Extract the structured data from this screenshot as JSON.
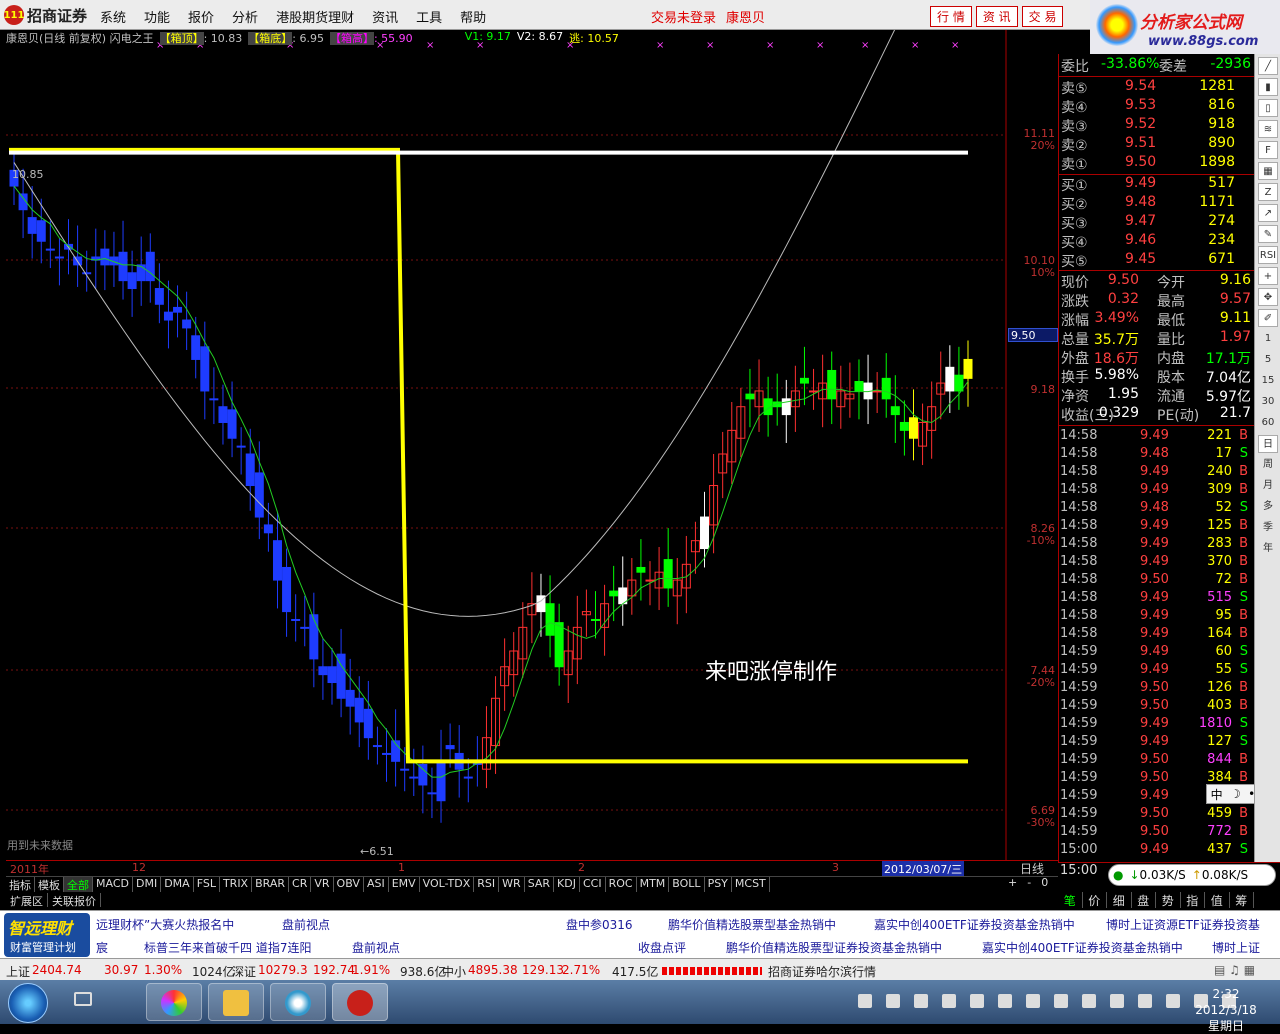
{
  "menubar": {
    "logo_text": "招商证券",
    "items": [
      "系统",
      "功能",
      "报价",
      "分析",
      "港股期货理财",
      "资讯",
      "工具",
      "帮助"
    ],
    "status": "交易未登录",
    "stock_name": "康恩贝",
    "quick_buttons": [
      "行 情",
      "资 讯",
      "交 易"
    ]
  },
  "banner": {
    "title": "分析家公式网",
    "url": "www.88gs.com"
  },
  "infobar": {
    "title": "康恩贝(日线 前复权) 闪电之王",
    "box_top_label": "【箱顶】",
    "box_top_value": ": 10.83",
    "box_bottom_label": "【箱底】",
    "box_bottom_value": ": 6.95",
    "box_high_label": "【箱高】",
    "box_high_value": ": 55.90",
    "v1": "V1: 9.17",
    "v2": "V2: 8.67",
    "escape": "逃: 10.57"
  },
  "chart": {
    "annotation": "来吧涨停制作",
    "future_note": "用到未来数据",
    "max_label": "10.85",
    "min_label": "←6.51",
    "price_axis": [
      {
        "price": "11.11",
        "pct": "20%"
      },
      {
        "price": "10.10",
        "pct": "10%"
      },
      {
        "price": "9.18",
        "pct": ""
      },
      {
        "price": "8.26",
        "pct": "-10%"
      },
      {
        "price": "7.44",
        "pct": "-20%"
      },
      {
        "price": "6.69",
        "pct": "-30%"
      }
    ],
    "current_price": "9.50",
    "date_labels": [
      "2011年",
      "12",
      "1",
      "2",
      "3"
    ],
    "current_date": "2012/03/07/三",
    "period": "日线"
  },
  "chart_data": {
    "type": "candlestick",
    "title": "康恩贝(日线 前复权) 闪电之王",
    "box_top": 10.83,
    "box_bottom": 6.95,
    "max_price": 10.85,
    "min_price": 6.51,
    "current_price": 9.5,
    "ylim": [
      6.4,
      11.4
    ]
  },
  "tabs": [
    "指标",
    "模板",
    "全部",
    "MACD",
    "DMI",
    "DMA",
    "FSL",
    "TRIX",
    "BRAR",
    "CR",
    "VR",
    "OBV",
    "ASI",
    "EMV",
    "VOL-TDX",
    "RSI",
    "WR",
    "SAR",
    "KDJ",
    "CCI",
    "ROC",
    "MTM",
    "BOLL",
    "PSY",
    "MCST"
  ],
  "tabs2": [
    "扩展区",
    "关联报价"
  ],
  "zoom": [
    "+",
    "-",
    "0"
  ],
  "quote": {
    "weibi_label": "委比",
    "weibi": "-33.86%",
    "weicha_label": "委差",
    "weicha": "-2936",
    "sells": [
      {
        "label": "卖⑤",
        "price": "9.54",
        "vol": "1281"
      },
      {
        "label": "卖④",
        "price": "9.53",
        "vol": "816"
      },
      {
        "label": "卖③",
        "price": "9.52",
        "vol": "918"
      },
      {
        "label": "卖②",
        "price": "9.51",
        "vol": "890"
      },
      {
        "label": "卖①",
        "price": "9.50",
        "vol": "1898"
      }
    ],
    "buys": [
      {
        "label": "买①",
        "price": "9.49",
        "vol": "517"
      },
      {
        "label": "买②",
        "price": "9.48",
        "vol": "1171"
      },
      {
        "label": "买③",
        "price": "9.47",
        "vol": "274"
      },
      {
        "label": "买④",
        "price": "9.46",
        "vol": "234"
      },
      {
        "label": "买⑤",
        "price": "9.45",
        "vol": "671"
      }
    ],
    "stats": [
      {
        "l1": "现价",
        "v1": "9.50",
        "l2": "今开",
        "v2": "9.16"
      },
      {
        "l1": "涨跌",
        "v1": "0.32",
        "l2": "最高",
        "v2": "9.57"
      },
      {
        "l1": "涨幅",
        "v1": "3.49%",
        "l2": "最低",
        "v2": "9.11"
      },
      {
        "l1": "总量",
        "v1": "35.7万",
        "l2": "量比",
        "v2": "1.97"
      },
      {
        "l1": "外盘",
        "v1": "18.6万",
        "l2": "内盘",
        "v2": "17.1万"
      },
      {
        "l1": "换手",
        "v1": "5.98%",
        "l2": "股本",
        "v2": "7.04亿"
      },
      {
        "l1": "净资",
        "v1": "1.95",
        "l2": "流通",
        "v2": "5.97亿"
      },
      {
        "l1": "收益(三)",
        "v1": "0.329",
        "l2": "PE(动)",
        "v2": "21.7"
      }
    ]
  },
  "ticks": [
    {
      "t": "14:58",
      "p": "9.49",
      "v": "221",
      "s": "B"
    },
    {
      "t": "14:58",
      "p": "9.48",
      "v": "17",
      "s": "S"
    },
    {
      "t": "14:58",
      "p": "9.49",
      "v": "240",
      "s": "B"
    },
    {
      "t": "14:58",
      "p": "9.49",
      "v": "309",
      "s": "B"
    },
    {
      "t": "14:58",
      "p": "9.48",
      "v": "52",
      "s": "S"
    },
    {
      "t": "14:58",
      "p": "9.49",
      "v": "125",
      "s": "B"
    },
    {
      "t": "14:58",
      "p": "9.49",
      "v": "283",
      "s": "B"
    },
    {
      "t": "14:58",
      "p": "9.49",
      "v": "370",
      "s": "B"
    },
    {
      "t": "14:58",
      "p": "9.50",
      "v": "72",
      "s": "B"
    },
    {
      "t": "14:58",
      "p": "9.49",
      "v": "515",
      "s": "S"
    },
    {
      "t": "14:58",
      "p": "9.49",
      "v": "95",
      "s": "B"
    },
    {
      "t": "14:58",
      "p": "9.49",
      "v": "164",
      "s": "B"
    },
    {
      "t": "14:59",
      "p": "9.49",
      "v": "60",
      "s": "S"
    },
    {
      "t": "14:59",
      "p": "9.49",
      "v": "55",
      "s": "S"
    },
    {
      "t": "14:59",
      "p": "9.50",
      "v": "126",
      "s": "B"
    },
    {
      "t": "14:59",
      "p": "9.50",
      "v": "403",
      "s": "B"
    },
    {
      "t": "14:59",
      "p": "9.49",
      "v": "1810",
      "s": "S"
    },
    {
      "t": "14:59",
      "p": "9.49",
      "v": "127",
      "s": "S"
    },
    {
      "t": "14:59",
      "p": "9.50",
      "v": "844",
      "s": "B"
    },
    {
      "t": "14:59",
      "p": "9.50",
      "v": "384",
      "s": "B"
    },
    {
      "t": "14:59",
      "p": "9.49",
      "v": "",
      "s": ""
    },
    {
      "t": "14:59",
      "p": "9.50",
      "v": "459",
      "s": "B"
    },
    {
      "t": "14:59",
      "p": "9.50",
      "v": "772",
      "s": "B"
    },
    {
      "t": "15:00",
      "p": "9.49",
      "v": "437",
      "s": "S"
    }
  ],
  "ticks_last_time": "15:00",
  "right_tabs": [
    "笔",
    "价",
    "细",
    "盘",
    "势",
    "指",
    "值",
    "筹"
  ],
  "network": {
    "down": "0.03K/S",
    "up": "0.08K/S"
  },
  "ime": {
    "label": "中"
  },
  "toolstrip": [
    "RSI",
    "1",
    "5",
    "15",
    "30",
    "60",
    "日",
    "周",
    "月",
    "多",
    "季",
    "年"
  ],
  "news": {
    "logo_a": "智远理财",
    "logo_b": "财富管理计划",
    "row1": [
      "远理财杯”大赛火热报名中",
      "盘前视点",
      "盘中参0316",
      "鹏华价值精选股票型基金热销中",
      "嘉实中创400ETF证券投资基金热销中",
      "博时上证资源ETF证券投资基"
    ],
    "row2": [
      "宸",
      "标普三年来首破千四 道指7连阳",
      "盘前视点",
      "收盘点评",
      "鹏华价值精选股票型证券投资基金热销中",
      "嘉实中创400ETF证券投资基金热销中",
      "博时上证"
    ]
  },
  "statusbar": {
    "sh_label": "上证",
    "sh": "2404.74",
    "sh_chg": "30.97",
    "sh_pct": "1.30%",
    "sh_amt": "1024亿",
    "sz_label": "深证",
    "sz": "10279.3",
    "sz_chg": "192.74",
    "sz_pct": "1.91%",
    "sz_amt": "938.6亿",
    "zx_label": "中小",
    "zx": "4895.38",
    "zx_chg": "129.13",
    "zx_pct": "2.71%",
    "zx_amt": "417.5亿",
    "broker": "招商证券哈尔滨行情"
  },
  "taskbar": {
    "time": "2:32",
    "date": "2012/3/18 星期日"
  }
}
